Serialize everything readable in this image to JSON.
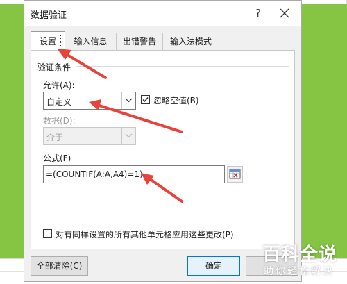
{
  "dialog": {
    "title": "数据验证",
    "help": "?",
    "tabs": [
      {
        "label": "设置",
        "active": true
      },
      {
        "label": "输入信息",
        "active": false
      },
      {
        "label": "出错警告",
        "active": false
      },
      {
        "label": "输入法模式",
        "active": false
      }
    ],
    "section_title": "验证条件",
    "allow": {
      "label": "允许(A):",
      "value": "自定义"
    },
    "ignore_blank": {
      "label": "忽略空值(B)",
      "checked": true
    },
    "data": {
      "label": "数据(D):",
      "value": "介于",
      "disabled": true
    },
    "formula": {
      "label": "公式(F)",
      "value": "=(COUNTIF(A:A,A4)=1)"
    },
    "apply_all": {
      "label": "对有同样设置的所有其他单元格应用这些更改(P)",
      "checked": false
    },
    "buttons": {
      "clear_all": "全部清除(C)",
      "ok": "确定"
    }
  },
  "watermark": {
    "main": "百科全说",
    "sub": "助你轻松解决"
  },
  "colors": {
    "background": "#86c443",
    "annotation_arrow": "#e8433a",
    "accent": "#0078d7"
  }
}
